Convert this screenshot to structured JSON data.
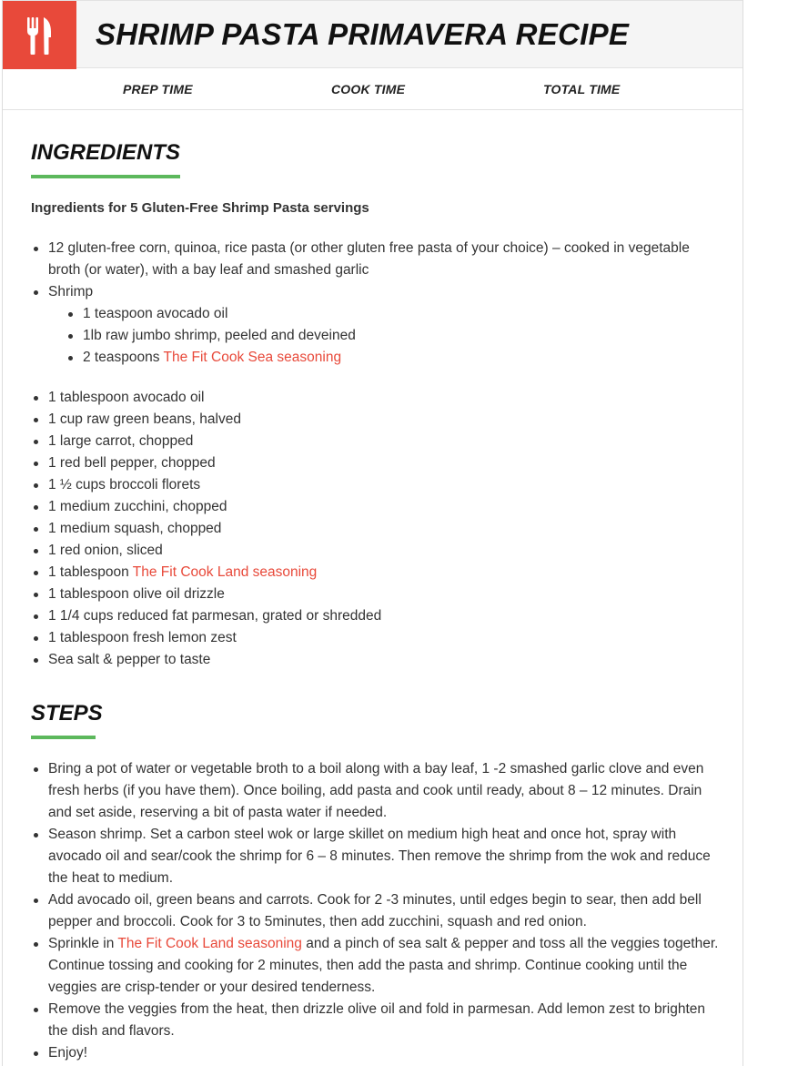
{
  "header": {
    "title": "SHRIMP PASTA PRIMAVERA RECIPE",
    "icon": "fork-knife-icon",
    "accent": "#e8493a"
  },
  "times": {
    "prep": "PREP TIME",
    "cook": "COOK TIME",
    "total": "TOTAL TIME"
  },
  "ingredients": {
    "heading": "INGREDIENTS",
    "underline_color": "#5cb85c",
    "subhead": "Ingredients for 5 Gluten-Free Shrimp Pasta servings",
    "pasta": "12 gluten-free corn, quinoa, rice pasta (or other gluten free pasta of your choice) – cooked in vegetable broth (or water), with a bay leaf and smashed garlic",
    "shrimp": {
      "label": "Shrimp",
      "items": [
        "1 teaspoon avocado oil",
        "1lb raw jumbo shrimp, peeled and deveined"
      ],
      "seasoning_pre": "2 teaspoons ",
      "seasoning_link": "The Fit Cook Sea seasoning"
    },
    "veg_a": [
      "1 tablespoon avocado oil",
      "1 cup raw green beans, halved",
      "1 large carrot, chopped",
      "1 red bell pepper, chopped",
      "1 ½ cups broccoli florets",
      "1 medium zucchini, chopped",
      "1 medium squash, chopped",
      "1 red onion, sliced"
    ],
    "land_pre": "1 tablespoon ",
    "land_link": "The Fit Cook Land seasoning",
    "veg_b": [
      "1 tablespoon olive oil drizzle",
      "1 1/4 cups reduced fat parmesan, grated or shredded",
      "1 tablespoon fresh lemon zest",
      "Sea salt & pepper to taste"
    ]
  },
  "steps": {
    "heading": "STEPS",
    "s1": "Bring a pot of water or vegetable broth to a boil along with a bay leaf, 1 -2 smashed garlic clove and even fresh herbs (if you have them).  Once boiling, add pasta and cook until ready, about 8 – 12 minutes.  Drain and set aside, reserving a bit of pasta water if needed.",
    "s2": "Season shrimp.  Set a carbon steel wok or large skillet on medium high heat and once hot, spray with avocado oil and sear/cook the shrimp for 6 – 8 minutes.  Then remove the shrimp from the wok and reduce the heat to medium.",
    "s3": "Add avocado oil, green beans and carrots.  Cook for 2 -3 minutes, until edges begin to sear, then add bell pepper and broccoli.  Cook for 3 to 5minutes, then add zucchini, squash and red onion.",
    "s4_pre": "Sprinkle in ",
    "s4_link": "The Fit Cook Land seasoning",
    "s4_post": " and a pinch of sea salt & pepper and toss all the veggies together.  Continue tossing and cooking for 2 minutes, then add the pasta and shrimp.  Continue cooking until the veggies are crisp-tender or your desired tenderness.",
    "s5": "Remove the veggies from the heat, then drizzle olive oil and fold in parmesan.  Add lemon zest to brighten the dish and flavors.",
    "s6": "Enjoy!"
  }
}
